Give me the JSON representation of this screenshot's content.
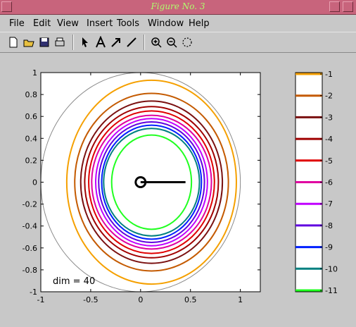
{
  "window": {
    "title": "Figure No. 3"
  },
  "menu": [
    "File",
    "Edit",
    "View",
    "Insert",
    "Tools",
    "Window",
    "Help"
  ],
  "toolbar": [
    "new-icon",
    "open-icon",
    "save-icon",
    "print-icon",
    "pointer-icon",
    "text-icon",
    "arrow-icon",
    "line-icon",
    "zoom-in-icon",
    "zoom-out-icon",
    "rotate-icon"
  ],
  "chart_data": {
    "type": "contour",
    "xlim": [
      -1,
      1.2
    ],
    "ylim": [
      -1,
      1
    ],
    "x_ticks": [
      "-1",
      "-0.5",
      "0",
      "0.5",
      "1"
    ],
    "y_ticks": [
      "1",
      "0.8",
      "0.6",
      "0.4",
      "0.2",
      "0",
      "-0.2",
      "-0.4",
      "-0.6",
      "-0.8",
      "-1"
    ],
    "annotation": "dim = 40",
    "levels": [
      {
        "level": "-1",
        "color": "#f5a000",
        "cx": 0.11,
        "cy": 0.0,
        "rx": 0.85,
        "ry": 0.93
      },
      {
        "level": "-2",
        "color": "#c45a00",
        "cx": 0.11,
        "cy": 0.0,
        "rx": 0.77,
        "ry": 0.81
      },
      {
        "level": "-3",
        "color": "#7a1010",
        "cx": 0.11,
        "cy": 0.0,
        "rx": 0.71,
        "ry": 0.74
      },
      {
        "level": "-4",
        "color": "#a00000",
        "cx": 0.11,
        "cy": 0.0,
        "rx": 0.67,
        "ry": 0.69
      },
      {
        "level": "-5",
        "color": "#e00000",
        "cx": 0.11,
        "cy": 0.0,
        "rx": 0.63,
        "ry": 0.65
      },
      {
        "level": "-6",
        "color": "#e000a0",
        "cx": 0.11,
        "cy": 0.0,
        "rx": 0.6,
        "ry": 0.61
      },
      {
        "level": "-7",
        "color": "#c000ff",
        "cx": 0.11,
        "cy": 0.0,
        "rx": 0.56,
        "ry": 0.58
      },
      {
        "level": "-8",
        "color": "#6000e0",
        "cx": 0.11,
        "cy": 0.0,
        "rx": 0.53,
        "ry": 0.55
      },
      {
        "level": "-9",
        "color": "#0020ff",
        "cx": 0.11,
        "cy": 0.0,
        "rx": 0.5,
        "ry": 0.52
      },
      {
        "level": "-10",
        "color": "#008080",
        "cx": 0.11,
        "cy": 0.0,
        "rx": 0.48,
        "ry": 0.49
      },
      {
        "level": "-11",
        "color": "#20ff20",
        "cx": 0.11,
        "cy": 0.0,
        "rx": 0.4,
        "ry": 0.43
      }
    ],
    "unit_circle": {
      "cx": 0.0,
      "cy": 0.0,
      "r": 1.0,
      "color": "#888888"
    },
    "needle": {
      "x0": 0.0,
      "x1": 0.45,
      "y": 0.0
    }
  }
}
